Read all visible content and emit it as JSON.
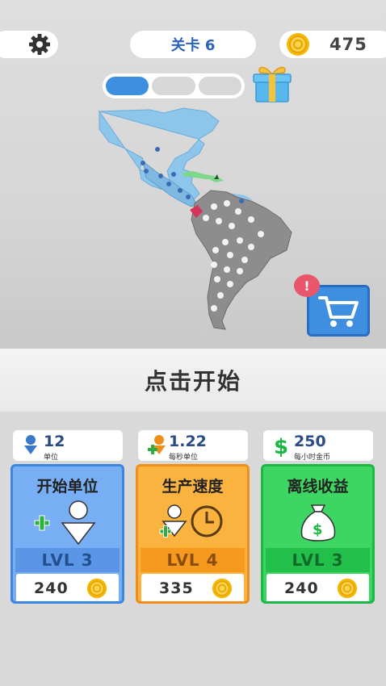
{
  "header": {
    "level_label": "关卡 6",
    "coins": "475"
  },
  "progress": {
    "completed_segments": 1,
    "total_segments": 3
  },
  "main": {
    "start_prompt": "点击开始",
    "shop_badge": "!"
  },
  "stats": [
    {
      "value": "12",
      "label": "单位"
    },
    {
      "value": "1.22",
      "label": "每秒单位"
    },
    {
      "value": "250",
      "label": "每小时金币"
    }
  ],
  "upgrades": [
    {
      "title": "开始单位",
      "level": "LVL 3",
      "cost": "240"
    },
    {
      "title": "生产速度",
      "level": "LVL 4",
      "cost": "335"
    },
    {
      "title": "离线收益",
      "level": "LVL 3",
      "cost": "240"
    }
  ],
  "colors": {
    "accent_blue": "#3f8fe0",
    "card_blue": "#77aef4",
    "card_orange": "#fbb33f",
    "card_green": "#3ed662",
    "badge_red": "#e9556a"
  },
  "icons": [
    "gear-icon",
    "coin-icon",
    "gift-icon",
    "cart-icon",
    "map",
    "unit-icon",
    "clock-icon",
    "money-bag-icon",
    "dollar-icon"
  ]
}
